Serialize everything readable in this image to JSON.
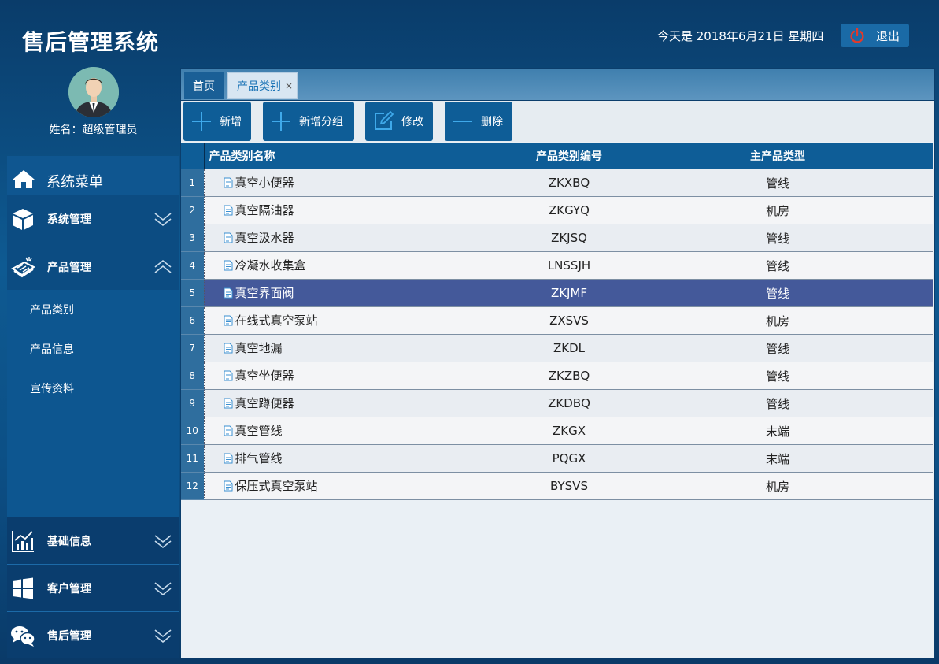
{
  "header": {
    "app_title": "售后管理系统",
    "date_text": "今天是 2018年6月21日 星期四",
    "logout_label": "退出"
  },
  "profile": {
    "user_name": "姓名：超级管理员"
  },
  "sidebar": {
    "menu_title": "系统菜单",
    "groups": [
      {
        "label": "系统管理",
        "icon": "cube-icon",
        "expanded": false
      },
      {
        "label": "产品管理",
        "icon": "product-icon",
        "expanded": true
      },
      {
        "label": "基础信息",
        "icon": "chart-icon",
        "expanded": false
      },
      {
        "label": "客户管理",
        "icon": "windows-icon",
        "expanded": false
      },
      {
        "label": "售后管理",
        "icon": "chat-icon",
        "expanded": false
      }
    ],
    "product_sub_items": [
      {
        "label": "产品类别"
      },
      {
        "label": "产品信息"
      },
      {
        "label": "宣传资料"
      }
    ]
  },
  "tabs": [
    {
      "label": "首页"
    },
    {
      "label": "产品类别",
      "close": "×",
      "active": true
    }
  ],
  "toolbar": {
    "add_label": "新增",
    "add_group_label": "新增分组",
    "edit_label": "修改",
    "delete_label": "删除"
  },
  "table": {
    "headers": [
      "产品类别名称",
      "产品类别编号",
      "主产品类型"
    ],
    "selected_row": 5,
    "rows": [
      {
        "num": "1",
        "name": "真空小便器",
        "code": "ZKXBQ",
        "type": "管线"
      },
      {
        "num": "2",
        "name": "真空隔油器",
        "code": "ZKGYQ",
        "type": "机房"
      },
      {
        "num": "3",
        "name": "真空汲水器",
        "code": "ZKJSQ",
        "type": "管线"
      },
      {
        "num": "4",
        "name": "冷凝水收集盒",
        "code": "LNSSJH",
        "type": "管线"
      },
      {
        "num": "5",
        "name": "真空界面阀",
        "code": "ZKJMF",
        "type": "管线"
      },
      {
        "num": "6",
        "name": "在线式真空泵站",
        "code": "ZXSVS",
        "type": "机房"
      },
      {
        "num": "7",
        "name": "真空地漏",
        "code": "ZKDL",
        "type": "管线"
      },
      {
        "num": "8",
        "name": "真空坐便器",
        "code": "ZKZBQ",
        "type": "管线"
      },
      {
        "num": "9",
        "name": "真空蹲便器",
        "code": "ZKDBQ",
        "type": "管线"
      },
      {
        "num": "10",
        "name": "真空管线",
        "code": "ZKGX",
        "type": "末端"
      },
      {
        "num": "11",
        "name": "排气管线",
        "code": "PQGX",
        "type": "末端"
      },
      {
        "num": "12",
        "name": "保压式真空泵站",
        "code": "BYSVS",
        "type": "机房"
      }
    ]
  }
}
